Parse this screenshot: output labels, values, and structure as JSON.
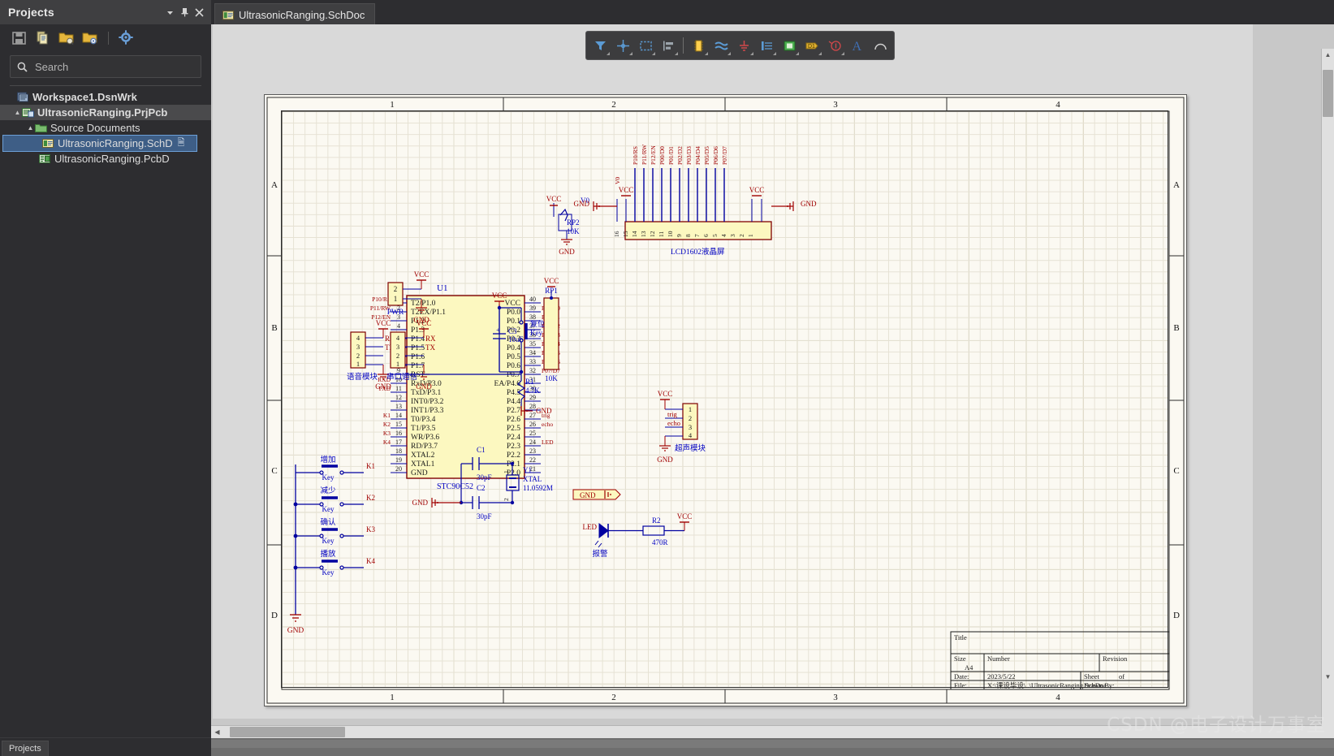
{
  "panel": {
    "title": "Projects",
    "buttons": [
      {
        "name": "panel-dropdown-button",
        "glyph": "▼"
      },
      {
        "name": "panel-pin-button",
        "glyph": "📌"
      },
      {
        "name": "panel-close-button",
        "glyph": "✕"
      }
    ],
    "toolbar_icons": [
      "save-icon",
      "copy-document-icon",
      "open-project-icon",
      "open-folder-icon",
      "settings-gear-icon"
    ],
    "search": {
      "placeholder": "Search",
      "value": ""
    },
    "tree": [
      {
        "label": "Workspace1.DsnWrk",
        "icon": "workspace-icon",
        "indent": 0,
        "bold": true,
        "state": "normal",
        "arrow": ""
      },
      {
        "label": "UltrasonicRanging.PrjPcb",
        "icon": "project-icon",
        "indent": 1,
        "bold": true,
        "state": "highlight",
        "arrow": "▲"
      },
      {
        "label": "Source Documents",
        "icon": "folder-icon",
        "indent": 2,
        "bold": false,
        "state": "normal",
        "arrow": "▲"
      },
      {
        "label": "UltrasonicRanging.SchD",
        "icon": "schdoc-icon",
        "indent": 3,
        "bold": false,
        "state": "selected",
        "arrow": "",
        "badge": "🗎"
      },
      {
        "label": "UltrasonicRanging.PcbD",
        "icon": "pcbdoc-icon",
        "indent": 3,
        "bold": false,
        "state": "normal",
        "arrow": ""
      }
    ],
    "footer_tab": "Projects"
  },
  "tab": {
    "label": "UltrasonicRanging.SchDoc",
    "icon": "schdoc-icon"
  },
  "floating_toolbar": [
    {
      "name": "filter-icon",
      "color": "#5b9bd5"
    },
    {
      "name": "crosshair-place-icon",
      "color": "#5b9bd5"
    },
    {
      "name": "select-area-icon",
      "color": "#5b9bd5"
    },
    {
      "name": "align-icon",
      "color": "#9aa3ab"
    },
    {
      "name": "place-component-icon",
      "color": "#ffcf4d"
    },
    {
      "name": "place-wire-icon",
      "color": "#5b9bd5"
    },
    {
      "name": "place-gnd-icon",
      "color": "#d0484a"
    },
    {
      "name": "place-port-icon",
      "color": "#5b9bd5"
    },
    {
      "name": "place-sheet-symbol-icon",
      "color": "#4caf50"
    },
    {
      "name": "place-net-label-icon",
      "color": "#e0b030"
    },
    {
      "name": "place-no-erc-icon",
      "color": "#d0484a"
    },
    {
      "name": "place-text-icon",
      "color": "#3f6fb5"
    },
    {
      "name": "place-arc-icon",
      "color": "#d0d0d0"
    }
  ],
  "sheet": {
    "zones_top": [
      "1",
      "2",
      "3",
      "4"
    ],
    "zones_bottom": [
      "1",
      "2",
      "3",
      "4"
    ],
    "zones_left": [
      "A",
      "B",
      "C",
      "D"
    ],
    "zones_right": [
      "A",
      "B",
      "C",
      "D"
    ],
    "title_block": {
      "title_label": "Title",
      "title_value": "",
      "size_label": "Size",
      "size_value": "A4",
      "number_label": "Number",
      "number_value": "",
      "revision_label": "Revision",
      "revision_value": "",
      "date_label": "Date:",
      "date_value": "2023/5/22",
      "sheet_label": "Sheet",
      "sheet_of": "of",
      "file_label": "File:",
      "file_value": "X:\\课设毕设\\..\\UltrasonicRanging.SchDoc",
      "drawn_by_label": "Drawn By:"
    }
  },
  "schematic": {
    "components": [
      {
        "designator": "U1",
        "value": "STC90C52",
        "name": "microcontroller-u1"
      },
      {
        "designator": "RP1",
        "value": "10K",
        "name": "resistor-pack-rp1"
      },
      {
        "designator": "RP2",
        "value": "10K",
        "name": "potentiometer-rp2"
      },
      {
        "designator": "R1",
        "value": "4.7K",
        "name": "resistor-r1"
      },
      {
        "designator": "R2",
        "value": "470R",
        "name": "resistor-r2"
      },
      {
        "designator": "C1",
        "value": "30pF",
        "name": "capacitor-c1"
      },
      {
        "designator": "C2",
        "value": "30pF",
        "name": "capacitor-c2"
      },
      {
        "designator": "C3",
        "value": "10uF",
        "name": "capacitor-c3"
      },
      {
        "designator": "Y1",
        "value": "XTAL",
        "value2": "11.0592M",
        "name": "crystal-y1"
      },
      {
        "designator": "K1",
        "value": "增加",
        "sub": "Key",
        "name": "key-k1"
      },
      {
        "designator": "K2",
        "value": "减少",
        "sub": "Key",
        "name": "key-k2"
      },
      {
        "designator": "K3",
        "value": "确认",
        "sub": "Key",
        "name": "key-k3"
      },
      {
        "designator": "K4",
        "value": "播放",
        "sub": "Key",
        "name": "key-k4"
      },
      {
        "designator": "LED",
        "value": "报警",
        "name": "led-alarm"
      },
      {
        "designator": "V0",
        "value": "",
        "name": "net-v0"
      }
    ],
    "labels": {
      "lcd": "LCD1602液晶屏",
      "pwr": "PWR",
      "voice_module": "语音模块",
      "serial_module": "串口通信",
      "ultrasonic_module": "超声模块",
      "reset_key": "复位",
      "reset_key_sub": "Key",
      "alarm": "报警",
      "trig": "trig",
      "echo": "echo",
      "rx": "RX",
      "tx": "TX",
      "vcc": "VCC",
      "gnd": "GND",
      "v0": "V0"
    },
    "u1_left_pins": [
      "T2/P1.0",
      "T2EX/P1.1",
      "P1.2",
      "P1.3",
      "P1.4",
      "P1.5",
      "P1.6",
      "P1.7",
      "RST",
      "RxD/P3.0",
      "TxD/P3.1",
      "INT0/P3.2",
      "INT1/P3.3",
      "T0/P3.4",
      "T1/P3.5",
      "WR/P3.6",
      "RD/P3.7",
      "XTAL2",
      "XTAL1",
      "GND"
    ],
    "u1_left_numbers": [
      "1",
      "2",
      "3",
      "4",
      "5",
      "6",
      "7",
      "8",
      "9",
      "10",
      "11",
      "12",
      "13",
      "14",
      "15",
      "16",
      "17",
      "18",
      "19",
      "20"
    ],
    "u1_right_pins": [
      "VCC",
      "P0.0",
      "P0.1",
      "P0.2",
      "P0.3",
      "P0.4",
      "P0.5",
      "P0.6",
      "P0.7",
      "EA/P4.6",
      "P4.5",
      "P4.4",
      "P2.7",
      "P2.6",
      "P2.5",
      "P2.4",
      "P2.3",
      "P2.2",
      "P2.1",
      "P2.0"
    ],
    "u1_right_numbers": [
      "40",
      "39",
      "38",
      "37",
      "36",
      "35",
      "34",
      "33",
      "32",
      "31",
      "30",
      "29",
      "28",
      "27",
      "26",
      "25",
      "24",
      "23",
      "22",
      "21"
    ],
    "u1_left_nets": [
      "P10/RS",
      "P11/RW",
      "P12/EN",
      "",
      "",
      "",
      "",
      "",
      "",
      "RXD",
      "TXD",
      "",
      "",
      "K1",
      "K2",
      "K3",
      "K4",
      "",
      "",
      ""
    ],
    "u1_right_nets": [
      "",
      "P00/D0",
      "P01/D1",
      "P02/D2",
      "P03/D3",
      "P04/D4",
      "P05/D5",
      "P06/D6",
      "P07/D7",
      "",
      "",
      "",
      "",
      "trig",
      "echo",
      "",
      "LED",
      "",
      "",
      ""
    ],
    "lcd_pin_nets": [
      "P10/RS",
      "P11/RW",
      "P12/EN",
      "P00/D0",
      "P01/D1",
      "P02/D2",
      "P03/D3",
      "P04/D4",
      "P05/D5",
      "P06/D6",
      "P07/D7"
    ],
    "lcd_pin_numbers": [
      "16",
      "15",
      "14",
      "13",
      "12",
      "11",
      "10",
      "9",
      "8",
      "7",
      "6",
      "5",
      "4",
      "3",
      "2",
      "1"
    ],
    "conn4_pins": [
      "4",
      "3",
      "2",
      "1"
    ],
    "conn2_pins": [
      "2",
      "1"
    ],
    "ultra_pins": [
      "1",
      "2",
      "3",
      "4"
    ]
  },
  "colors": {
    "wire": "#0000a0",
    "component_fill": "#fcf8c0",
    "component_border": "#7f0000",
    "net_label": "#a00000",
    "designator": "#0000c0",
    "sheet_bg": "#fbf9f2",
    "panel_bg": "#2d2d30",
    "accent": "#3e5e86"
  },
  "watermark": "CSDN @电子设计万事室"
}
